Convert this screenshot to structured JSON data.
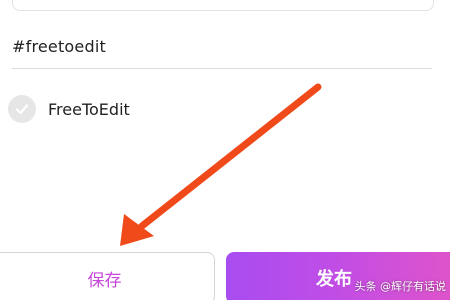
{
  "caption": {
    "tag_text": "#freetoedit"
  },
  "free_to_edit": {
    "label": "FreeToEdit",
    "checked": false
  },
  "actions": {
    "save_label": "保存",
    "publish_label": "发布"
  },
  "watermark": {
    "text": "头条 @辉仔有话说"
  },
  "colors": {
    "save_text": "#c548d8",
    "publish_gradient_start": "#a84cf0",
    "publish_gradient_end": "#e154c8",
    "arrow": "#f04a1a"
  }
}
